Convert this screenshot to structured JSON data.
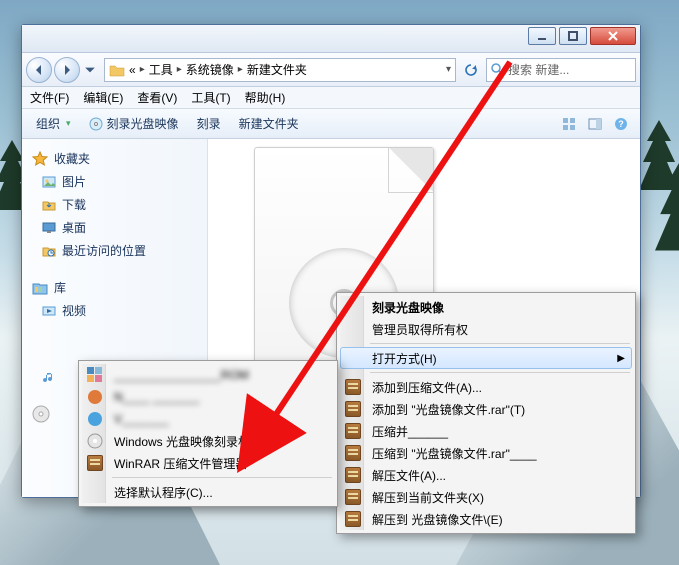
{
  "window": {
    "breadcrumbs": {
      "first_sep": "«",
      "items": [
        "工具",
        "系统镜像",
        "新建文件夹"
      ]
    },
    "search_placeholder": "搜索 新建...",
    "menubar": [
      "文件(F)",
      "编辑(E)",
      "查看(V)",
      "工具(T)",
      "帮助(H)"
    ],
    "toolbar": {
      "organize": "组织",
      "burn_image": "刻录光盘映像",
      "burn": "刻录",
      "new_folder": "新建文件夹"
    },
    "sidebar": {
      "favorites": "收藏夹",
      "fav_items": [
        "图片",
        "下载",
        "桌面",
        "最近访问的位置"
      ],
      "libraries": "库",
      "lib_items": [
        "视频"
      ]
    }
  },
  "context_left": {
    "items": [
      {
        "label": "________________ROM",
        "blur": true
      },
      {
        "label": "N____ _______",
        "blur": true
      },
      {
        "label": "V_______",
        "blur": true
      },
      {
        "label": "Windows 光盘映像刻录机",
        "blur": false
      },
      {
        "label": "WinRAR 压缩文件管理器",
        "blur": false
      }
    ],
    "footer": "选择默认程序(C)..."
  },
  "context_right": {
    "header": [
      "刻录光盘映像",
      "管理员取得所有权"
    ],
    "open_with": "打开方式(H)",
    "rar_items": [
      "添加到压缩文件(A)...",
      "添加到 \"光盘镜像文件.rar\"(T)",
      "压缩并______",
      "压缩到 \"光盘镜像文件.rar\"____",
      "解压文件(A)...",
      "解压到当前文件夹(X)",
      "解压到 光盘镜像文件\\(E)"
    ]
  }
}
